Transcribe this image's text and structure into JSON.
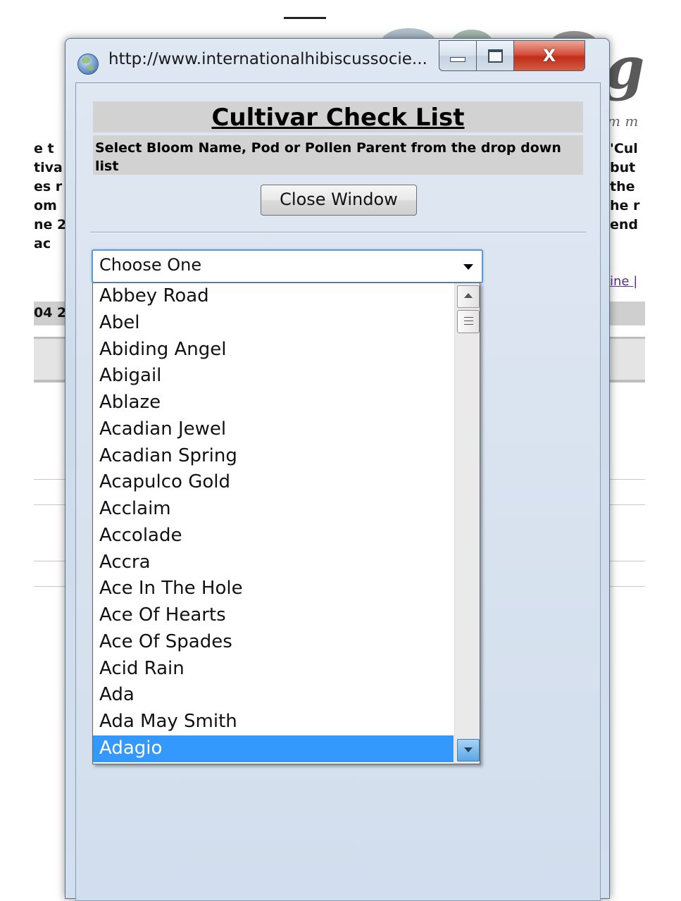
{
  "background_page": {
    "left_fragments": [
      "e t",
      "tiva",
      "es r",
      "om ",
      "ne 2",
      "ac"
    ],
    "right_fragments": [
      "'Cul",
      "but",
      "the",
      "he r",
      "end"
    ],
    "link_fragment": "ine |",
    "gray_band_fragment": "04 2",
    "header_letter": "g",
    "tagline_fragment": "m m"
  },
  "popup": {
    "url": "http://www.internationalhibiscussocie...",
    "window_controls": {
      "minimize_icon": "minimize-icon",
      "maximize_icon": "maximize-icon",
      "close_glyph": "X"
    },
    "title": "Cultivar Check List",
    "instruction": "Select Bloom Name, Pod or Pollen Parent from the drop down list",
    "close_button_label": "Close Window",
    "select": {
      "value": "Choose One",
      "options": [
        "Abbey Road",
        "Abel",
        "Abiding Angel",
        "Abigail",
        "Ablaze",
        "Acadian Jewel",
        "Acadian Spring",
        "Acapulco Gold",
        "Acclaim",
        "Accolade",
        "Accra",
        "Ace In The Hole",
        "Ace Of Hearts",
        "Ace Of Spades",
        "Acid Rain",
        "Ada",
        "Ada May Smith",
        "Adagio"
      ],
      "highlighted_option": "Adagio"
    }
  },
  "colors": {
    "highlight": "#3399ff",
    "popup_bg": "#d2deed",
    "band_gray": "#d2d2d2",
    "close_button_red": "#c22d18"
  }
}
